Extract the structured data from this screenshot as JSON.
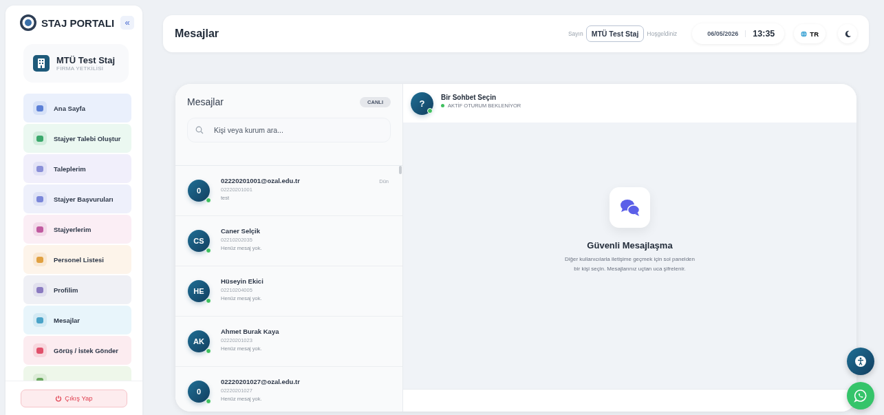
{
  "sidebar": {
    "brand": "STAJ PORTALI",
    "collapse": "«",
    "user": {
      "name": "MTÜ Test Staj",
      "role": "FİRMA YETKİLİSİ"
    },
    "items": [
      {
        "label": "Ana Sayfa",
        "color": "#eaf0fc"
      },
      {
        "label": "Stajyer Talebi Oluştur",
        "color": "#ebf8f1"
      },
      {
        "label": "Taleplerim",
        "color": "#f1effb"
      },
      {
        "label": "Stajyer Başvuruları",
        "color": "#eef0fb"
      },
      {
        "label": "Stajyerlerim",
        "color": "#fbeef5"
      },
      {
        "label": "Personel Listesi",
        "color": "#fdf4ea"
      },
      {
        "label": "Profilim",
        "color": "#eff0f5"
      },
      {
        "label": "Mesajlar",
        "color": "#e8f5fb"
      },
      {
        "label": "Görüş / İstek Gönder",
        "color": "#fcecf0"
      },
      {
        "color": "#eef7ea"
      }
    ],
    "logout": "Çıkış Yap"
  },
  "header": {
    "title": "Mesajlar",
    "greeting_pre": "Sayın",
    "user": "MTÜ Test Staj",
    "greeting_post": "Hoşgeldiniz",
    "date": "06/05/2026",
    "time": "13:35",
    "language": "TR"
  },
  "conversations": {
    "title": "Mesajlar",
    "badge": "CANLI",
    "search": {
      "placeholder": "Kişi veya kurum ara..."
    },
    "rows": [
      {
        "avatar": "0",
        "name": "02220201001@ozal.edu.tr",
        "id": "02220201001",
        "preview": "test",
        "time": "Dün",
        "online": true
      },
      {
        "avatar": "CS",
        "name": "Caner Selçik",
        "id": "02210202035",
        "preview": "Henüz mesaj yok.",
        "online": true
      },
      {
        "avatar": "HE",
        "name": "Hüseyin Ekici",
        "id": "02210204005",
        "preview": "Henüz mesaj yok.",
        "online": true
      },
      {
        "avatar": "AK",
        "name": "Ahmet Burak Kaya",
        "id": "02220201023",
        "preview": "Henüz mesaj yok.",
        "online": true
      },
      {
        "avatar": "0",
        "name": "02220201027@ozal.edu.tr",
        "id": "02220201027",
        "preview": "Henüz mesaj yok.",
        "online": true
      }
    ]
  },
  "chat": {
    "avatar": "?",
    "title": "Bir Sohbet Seçin",
    "status": "AKTİF OTURUM BEKLENİYOR",
    "online": true,
    "empty_title": "Güvenli Mesajlaşma",
    "empty_text": "Diğer kullanıcılarla iletişime geçmek için sol panelden bir kişi seçin. Mesajlarınız uçtan uca şifrelenir."
  }
}
